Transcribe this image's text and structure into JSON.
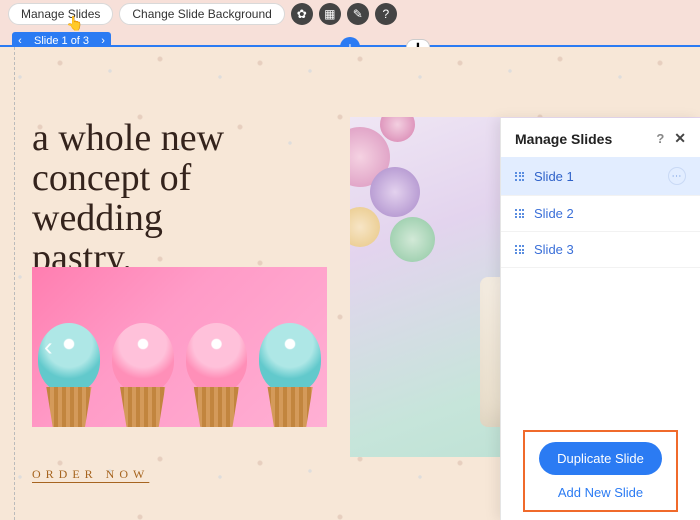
{
  "toolbar": {
    "manage_slides": "Manage Slides",
    "change_bg": "Change Slide Background"
  },
  "slide_nav": {
    "label": "Slide 1 of 3"
  },
  "slide_content": {
    "headline_l1": "a whole new",
    "headline_l2": "concept of",
    "headline_l3": "wedding",
    "headline_l4": "pastry.",
    "order_now": "ORDER NOW"
  },
  "panel": {
    "title": "Manage Slides",
    "slides": [
      {
        "label": "Slide 1",
        "selected": true
      },
      {
        "label": "Slide 2",
        "selected": false
      },
      {
        "label": "Slide 3",
        "selected": false
      }
    ],
    "duplicate": "Duplicate Slide",
    "add_new": "Add New Slide"
  }
}
